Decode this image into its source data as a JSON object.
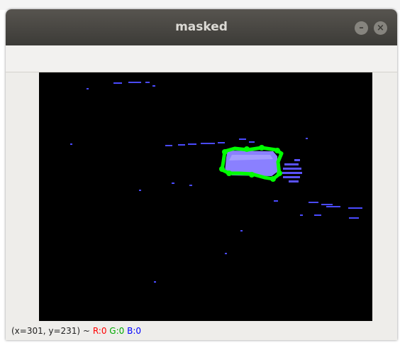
{
  "window": {
    "title": "masked",
    "minimize_symbol": "–",
    "close_symbol": "×"
  },
  "status": {
    "coords": "(x=301, y=231) ~",
    "r": "R:0",
    "g": "G:0",
    "b": "B:0"
  },
  "colors": {
    "titlebar": "#3c3b37",
    "image_background": "#000000",
    "mask_fill": "#8a80ff",
    "contour": "#00ff00",
    "noise": "#4a4aff",
    "pixel_r": "#ff0000",
    "pixel_g": "#00aa00",
    "pixel_b": "#0000ff"
  },
  "icons": [
    "minimize-icon",
    "close-icon"
  ]
}
